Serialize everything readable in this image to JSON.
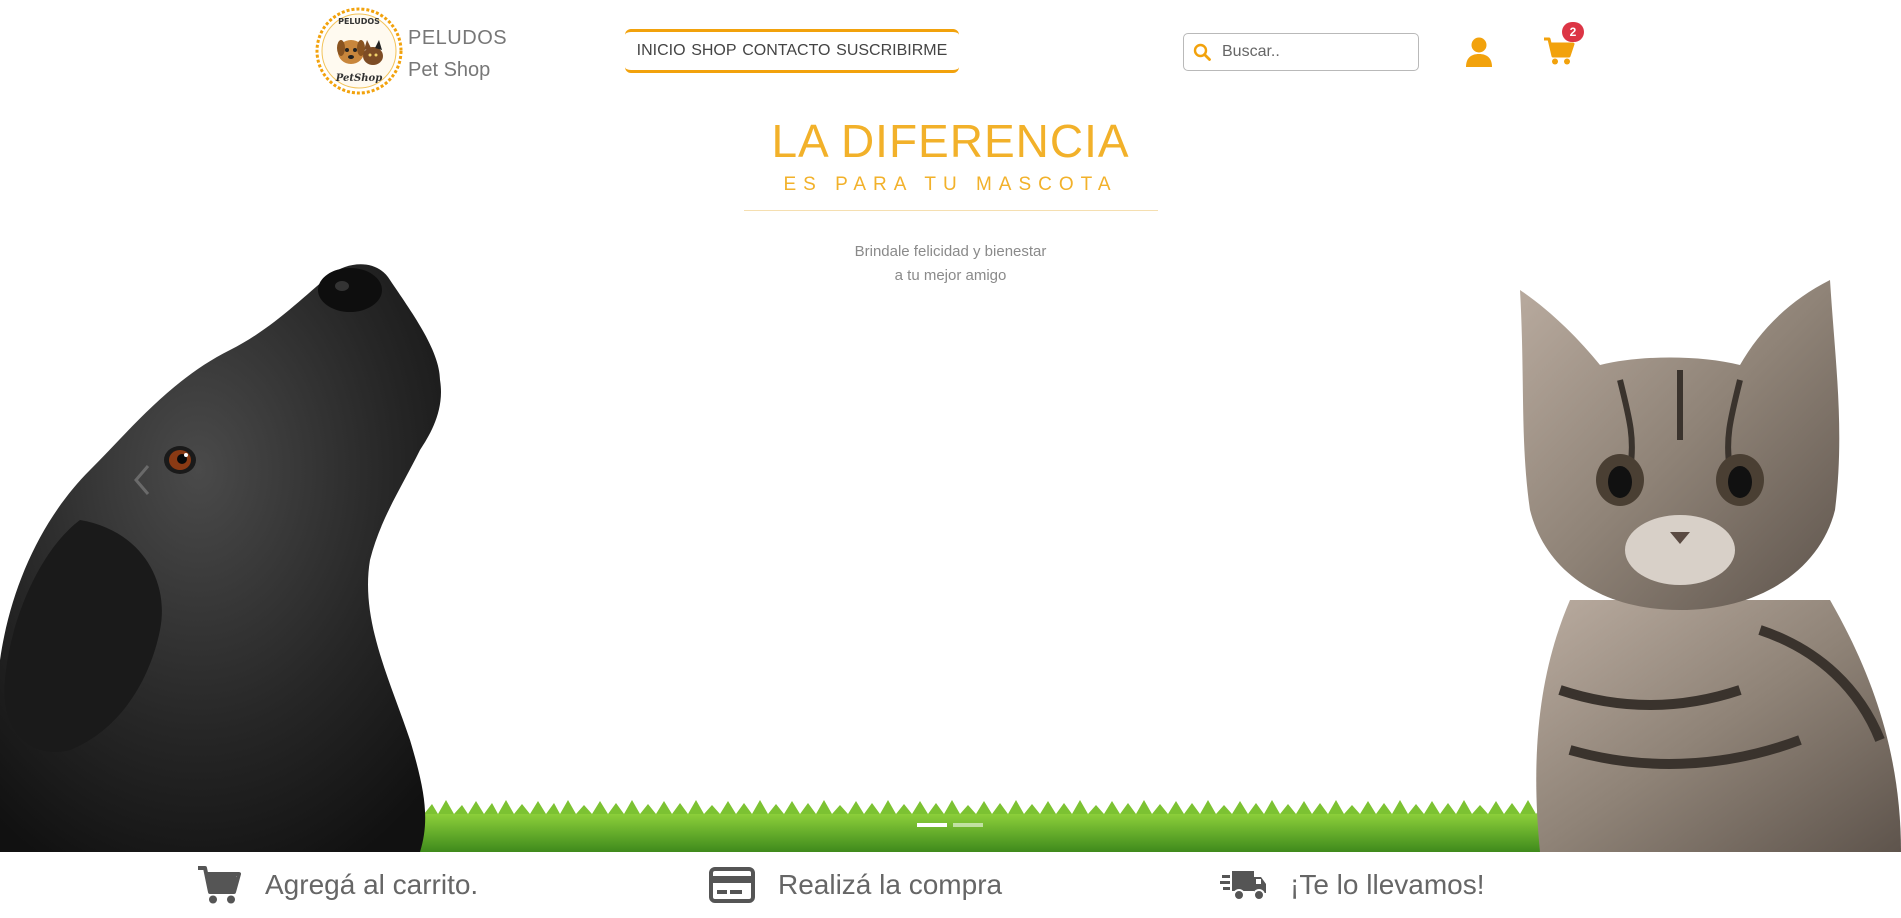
{
  "header": {
    "brand_name": "PELUDOS",
    "brand_sub": "Pet Shop",
    "logo_text_top": "PELUDOS",
    "logo_text_bottom": "PetShop",
    "nav": [
      {
        "label": "INICIO"
      },
      {
        "label": "SHOP"
      },
      {
        "label": "CONTACTO"
      },
      {
        "label": "SUSCRIBIRME"
      }
    ],
    "search_placeholder": "Buscar..",
    "cart_count": "2",
    "icons": [
      "search-icon",
      "user-icon",
      "cart-icon"
    ]
  },
  "hero": {
    "title": "LA DIFERENCIA",
    "subtitle": "ES PARA TU MASCOTA",
    "text_line1": "Brindale felicidad y bienestar",
    "text_line2": "a tu mejor amigo",
    "carousel_indicators": 2,
    "active_indicator": 0
  },
  "steps": [
    {
      "label": "Agregá al carrito.",
      "icon": "cart-icon"
    },
    {
      "label": "Realizá la compra",
      "icon": "credit-card-icon"
    },
    {
      "label": "¡Te lo llevamos!",
      "icon": "delivery-truck-icon"
    }
  ],
  "colors": {
    "accent": "#f2a20c",
    "title": "#f2b12a",
    "badge": "#dc3545",
    "step_icon": "#555555"
  }
}
